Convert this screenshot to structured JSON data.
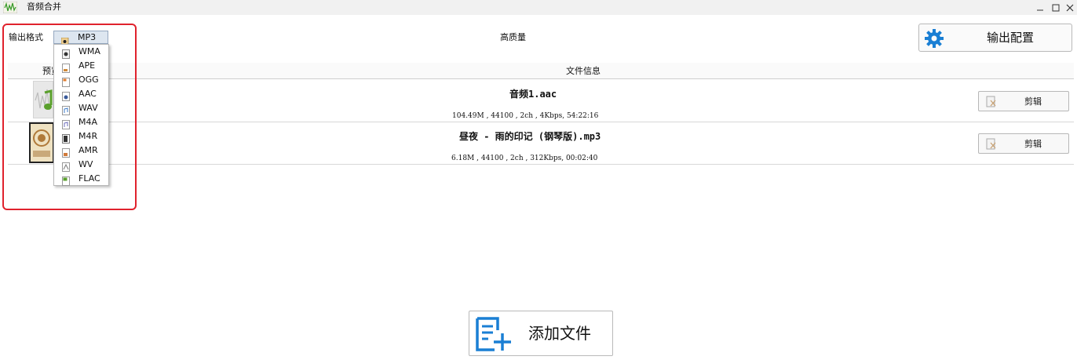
{
  "window": {
    "title": "音频合并",
    "logo_icon": "audio-wave-logo-icon",
    "controls": [
      "minimize-icon",
      "maximize-icon",
      "close-icon"
    ]
  },
  "toolbar": {
    "format_label": "输出格式",
    "format_selected": "MP3",
    "quality": "高质量",
    "output_config_label": "输出配置",
    "output_config_icon": "gear-icon"
  },
  "format_options": [
    {
      "label": "MP3",
      "selected": true
    },
    {
      "label": "WMA"
    },
    {
      "label": "APE"
    },
    {
      "label": "OGG"
    },
    {
      "label": "AAC"
    },
    {
      "label": "WAV"
    },
    {
      "label": "M4A"
    },
    {
      "label": "M4R"
    },
    {
      "label": "AMR"
    },
    {
      "label": "WV"
    },
    {
      "label": "FLAC"
    }
  ],
  "list": {
    "columns": {
      "preview": "预览",
      "info": "文件信息"
    },
    "files": [
      {
        "name": "音频1.aac",
        "meta": "104.49M , 44100 , 2ch , 4Kbps, 54:22:16",
        "cut_label": "剪辑"
      },
      {
        "name": "昼夜 - 雨的印记 (钢琴版).mp3",
        "meta": "6.18M , 44100 , 2ch , 312Kbps, 00:02:40",
        "cut_label": "剪辑"
      }
    ]
  },
  "add_file": {
    "label": "添加文件",
    "icon": "add-file-icon"
  },
  "colors": {
    "accent_blue": "#1a7fd4",
    "highlight_red": "#e0222d",
    "icon_green": "#5aa02c"
  }
}
